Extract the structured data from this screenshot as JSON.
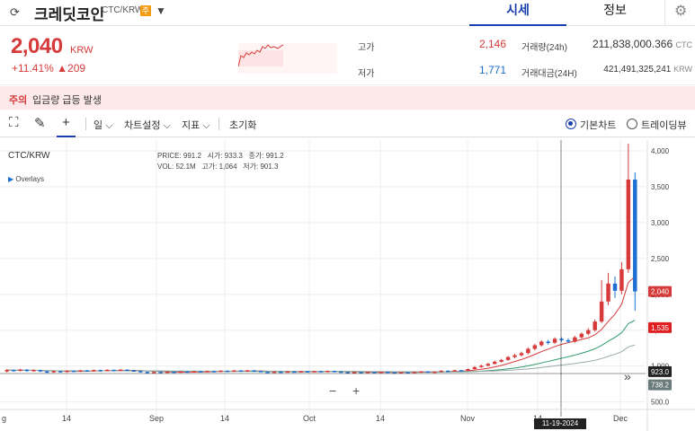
{
  "header": {
    "back_icon": "refresh-icon",
    "name": "크레딧코인",
    "pair": "CTC/KRW",
    "badge": "주",
    "caret": "▼",
    "tabs": [
      "시세",
      "정보"
    ]
  },
  "summary": {
    "price": "2,040",
    "currency": "KRW",
    "change_pct": "+11.41%",
    "change_abs": "▲209",
    "high_label": "고가",
    "high": "2,146",
    "low_label": "저가",
    "low": "1,771",
    "volume_label": "거래량(24h)",
    "volume": "211,838,000.366",
    "volume_unit": "CTC",
    "amount_label": "거래대금(24H)",
    "amount": "421,491,325,241",
    "amount_unit": "KRW"
  },
  "warning": {
    "tag": "주의",
    "text": "입금량 급등 발생"
  },
  "toolbar": {
    "interval": "일",
    "chart_settings": "차트설정",
    "indicators": "지표",
    "reset": "초기화",
    "basic_chart": "기본차트",
    "tradingview": "트레이딩뷰"
  },
  "chart": {
    "symbol": "CTC/KRW",
    "overlays": "Overlays",
    "ohlc": {
      "price_label": "PRICE:",
      "price": "991.2",
      "open_label": "시가:",
      "open": "933.3",
      "close_label": "종가:",
      "close": "991.2",
      "vol_label": "VOL:",
      "vol": "52.1M",
      "high_label": "고가:",
      "high": "1,064",
      "low_label": "저가:",
      "low": "901.3"
    },
    "crosshair_date": "11-19-2024",
    "zoom_minus": "−",
    "zoom_plus": "+",
    "scroll_icon": "»",
    "price_tags": {
      "last": "2,040",
      "ma": "1,535",
      "cross": "923.0",
      "ma2": "738.2"
    },
    "colors": {
      "up": "#d63a3a",
      "down": "#1d6fd1",
      "ma_red": "#d63a3a",
      "ma_green": "#2e9c6a",
      "ma_grey": "#9aa"
    }
  },
  "chart_data": {
    "type": "line",
    "y_ticks": [
      500.0,
      1000,
      1500,
      2000,
      2500,
      3000,
      3500,
      4000
    ],
    "y_tick_labels": [
      "500.0",
      "1,000",
      "1,500",
      "2,000",
      "2,500",
      "3,000",
      "3,500",
      "4,000"
    ],
    "ylim": [
      420,
      4100
    ],
    "x_tick_labels": [
      "g",
      "14",
      "Sep",
      "14",
      "Oct",
      "14",
      "Nov",
      "14",
      "Dec"
    ],
    "candles": [
      [
        0,
        925,
        945,
        960,
        910
      ],
      [
        1,
        945,
        935,
        955,
        925
      ],
      [
        2,
        935,
        950,
        962,
        928
      ],
      [
        3,
        950,
        930,
        958,
        920
      ],
      [
        4,
        930,
        945,
        955,
        922
      ],
      [
        5,
        945,
        925,
        950,
        915
      ],
      [
        6,
        925,
        912,
        935,
        905
      ],
      [
        7,
        912,
        930,
        940,
        905
      ],
      [
        8,
        930,
        918,
        938,
        910
      ],
      [
        9,
        918,
        935,
        942,
        910
      ],
      [
        10,
        935,
        922,
        940,
        915
      ],
      [
        11,
        922,
        940,
        948,
        918
      ],
      [
        12,
        940,
        928,
        946,
        920
      ],
      [
        13,
        928,
        945,
        952,
        922
      ],
      [
        14,
        945,
        932,
        950,
        925
      ],
      [
        15,
        932,
        948,
        955,
        926
      ],
      [
        16,
        948,
        936,
        952,
        930
      ],
      [
        17,
        936,
        950,
        958,
        930
      ],
      [
        18,
        950,
        940,
        955,
        932
      ],
      [
        19,
        940,
        930,
        946,
        922
      ],
      [
        20,
        930,
        918,
        935,
        910
      ],
      [
        21,
        918,
        905,
        925,
        898
      ],
      [
        22,
        905,
        918,
        925,
        898
      ],
      [
        23,
        918,
        908,
        924,
        900
      ],
      [
        24,
        908,
        922,
        930,
        902
      ],
      [
        25,
        922,
        912,
        928,
        905
      ],
      [
        26,
        912,
        925,
        932,
        906
      ],
      [
        27,
        925,
        915,
        930,
        908
      ],
      [
        28,
        915,
        928,
        935,
        910
      ],
      [
        29,
        928,
        918,
        932,
        912
      ],
      [
        30,
        918,
        930,
        938,
        912
      ],
      [
        31,
        930,
        922,
        936,
        915
      ],
      [
        32,
        922,
        935,
        942,
        916
      ],
      [
        33,
        935,
        925,
        940,
        918
      ],
      [
        34,
        925,
        938,
        945,
        920
      ],
      [
        35,
        938,
        928,
        942,
        922
      ],
      [
        36,
        928,
        940,
        946,
        922
      ],
      [
        37,
        940,
        932,
        945,
        925
      ],
      [
        38,
        932,
        920,
        936,
        912
      ],
      [
        39,
        920,
        912,
        925,
        905
      ],
      [
        40,
        912,
        922,
        928,
        906
      ],
      [
        41,
        922,
        915,
        926,
        908
      ],
      [
        42,
        915,
        925,
        930,
        910
      ],
      [
        43,
        925,
        918,
        928,
        912
      ],
      [
        44,
        918,
        928,
        933,
        913
      ],
      [
        45,
        928,
        920,
        932,
        914
      ],
      [
        46,
        920,
        930,
        935,
        915
      ],
      [
        47,
        930,
        922,
        934,
        916
      ],
      [
        48,
        922,
        932,
        938,
        917
      ],
      [
        49,
        932,
        924,
        936,
        918
      ],
      [
        50,
        924,
        914,
        928,
        906
      ],
      [
        51,
        914,
        906,
        918,
        900
      ],
      [
        52,
        906,
        915,
        920,
        900
      ],
      [
        53,
        915,
        908,
        918,
        902
      ],
      [
        54,
        908,
        918,
        922,
        903
      ],
      [
        55,
        918,
        910,
        920,
        904
      ],
      [
        56,
        910,
        920,
        925,
        905
      ],
      [
        57,
        920,
        912,
        923,
        906
      ],
      [
        58,
        912,
        905,
        915,
        898
      ],
      [
        59,
        905,
        915,
        920,
        899
      ],
      [
        60,
        915,
        908,
        918,
        902
      ],
      [
        61,
        908,
        918,
        923,
        903
      ],
      [
        62,
        918,
        925,
        930,
        910
      ],
      [
        63,
        925,
        915,
        928,
        909
      ],
      [
        64,
        915,
        922,
        927,
        910
      ],
      [
        65,
        922,
        935,
        942,
        918
      ],
      [
        66,
        935,
        928,
        940,
        922
      ],
      [
        67,
        928,
        942,
        950,
        924
      ],
      [
        68,
        942,
        935,
        946,
        928
      ],
      [
        69,
        935,
        958,
        965,
        930
      ],
      [
        70,
        958,
        985,
        1000,
        950
      ],
      [
        71,
        985,
        1005,
        1020,
        975
      ],
      [
        72,
        1005,
        1030,
        1045,
        995
      ],
      [
        73,
        1030,
        1060,
        1075,
        1020
      ],
      [
        74,
        1060,
        1085,
        1100,
        1050
      ],
      [
        75,
        1085,
        1125,
        1140,
        1075
      ],
      [
        76,
        1125,
        1150,
        1170,
        1110
      ],
      [
        77,
        1150,
        1180,
        1200,
        1135
      ],
      [
        78,
        1180,
        1240,
        1260,
        1165
      ],
      [
        79,
        1240,
        1290,
        1310,
        1220
      ],
      [
        80,
        1290,
        1340,
        1360,
        1270
      ],
      [
        81,
        1340,
        1325,
        1365,
        1300
      ],
      [
        82,
        1325,
        1380,
        1400,
        1310
      ],
      [
        83,
        1380,
        1360,
        1400,
        1340
      ],
      [
        84,
        1360,
        1340,
        1385,
        1320
      ],
      [
        85,
        1340,
        1400,
        1420,
        1325
      ],
      [
        86,
        1400,
        1450,
        1470,
        1385
      ],
      [
        87,
        1450,
        1500,
        1530,
        1430
      ],
      [
        88,
        1500,
        1620,
        1650,
        1480
      ],
      [
        89,
        1620,
        1900,
        2200,
        1600
      ],
      [
        90,
        1900,
        2150,
        2300,
        1850
      ],
      [
        91,
        2150,
        2050,
        2250,
        1950
      ],
      [
        92,
        2050,
        2350,
        2450,
        2000
      ],
      [
        93,
        2350,
        3600,
        4100,
        2300
      ],
      [
        94,
        3600,
        2040,
        3700,
        1771
      ]
    ]
  }
}
